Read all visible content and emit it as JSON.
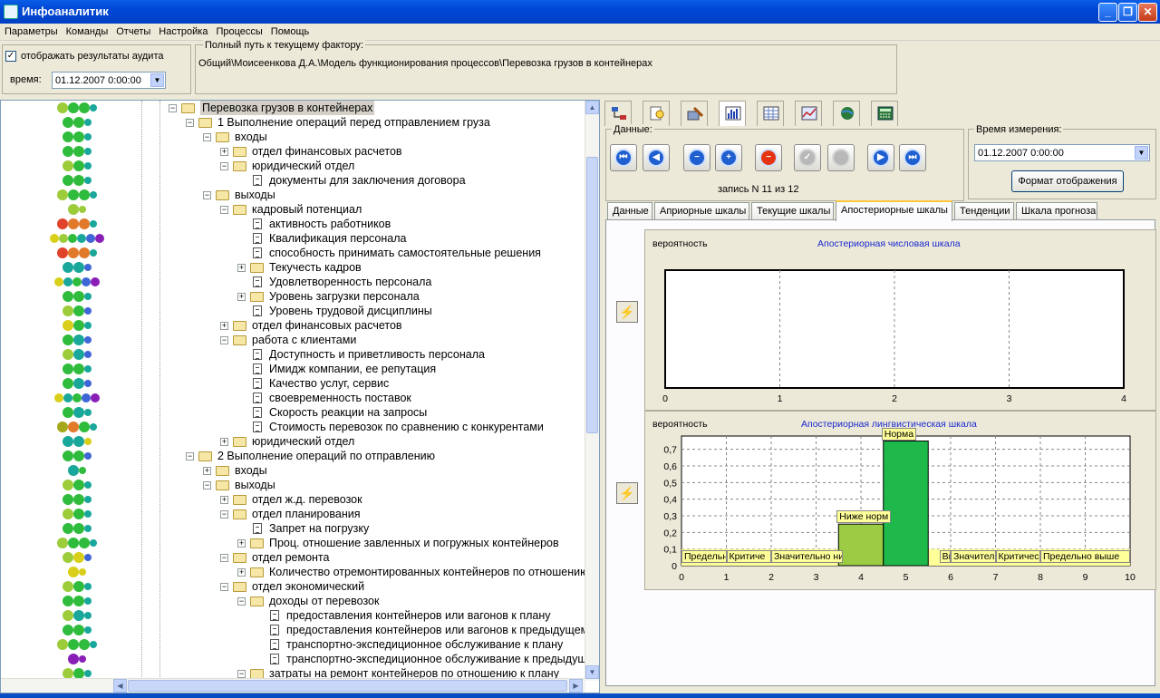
{
  "window": {
    "title": "Инфоаналитик"
  },
  "menu": [
    "Параметры",
    "Команды",
    "Отчеты",
    "Настройка",
    "Процессы",
    "Помощь"
  ],
  "audit": {
    "checkbox_label": "отображать результаты аудита",
    "checked": true,
    "time_label": "время:",
    "time_value": "01.12.2007  0:00:00"
  },
  "path": {
    "legend": "Полный путь к текущему фактору:",
    "value": "Общий\\Моисеенкова Д.А.\\Модель функционирования процессов\\Перевозка грузов в контейнерах"
  },
  "tree": [
    {
      "label": "Перевозка грузов в контейнерах",
      "level": 0,
      "kind": "folder",
      "expander": "-",
      "selected": true
    },
    {
      "label": "1 Выполнение операций перед отправлением груза",
      "level": 1,
      "kind": "folder",
      "expander": "-"
    },
    {
      "label": "входы",
      "level": 2,
      "kind": "folder",
      "expander": "-"
    },
    {
      "label": "отдел финансовых расчетов",
      "level": 3,
      "kind": "folder",
      "expander": "+"
    },
    {
      "label": "юридический отдел",
      "level": 3,
      "kind": "folder",
      "expander": "-"
    },
    {
      "label": "документы для заключения договора",
      "level": 4,
      "kind": "doc",
      "expander": ""
    },
    {
      "label": "выходы",
      "level": 2,
      "kind": "folder",
      "expander": "-"
    },
    {
      "label": "кадровый потенциал",
      "level": 3,
      "kind": "folder",
      "expander": "-"
    },
    {
      "label": "активность работников",
      "level": 4,
      "kind": "doc",
      "expander": ""
    },
    {
      "label": "Квалификация персонала",
      "level": 4,
      "kind": "doc",
      "expander": ""
    },
    {
      "label": "способность принимать самостоятельные решения",
      "level": 4,
      "kind": "doc",
      "expander": ""
    },
    {
      "label": "Текучесть кадров",
      "level": 4,
      "kind": "folder",
      "expander": "+"
    },
    {
      "label": "Удовлетворенность персонала",
      "level": 4,
      "kind": "doc",
      "expander": ""
    },
    {
      "label": "Уровень загрузки персонала",
      "level": 4,
      "kind": "folder",
      "expander": "+"
    },
    {
      "label": "Уровень трудовой дисциплины",
      "level": 4,
      "kind": "doc",
      "expander": ""
    },
    {
      "label": "отдел финансовых расчетов",
      "level": 3,
      "kind": "folder",
      "expander": "+"
    },
    {
      "label": "работа с клиентами",
      "level": 3,
      "kind": "folder",
      "expander": "-"
    },
    {
      "label": "Доступность и приветливость персонала",
      "level": 4,
      "kind": "doc",
      "expander": ""
    },
    {
      "label": "Имидж компании, ее репутация",
      "level": 4,
      "kind": "doc",
      "expander": ""
    },
    {
      "label": "Качество услуг, сервис",
      "level": 4,
      "kind": "doc",
      "expander": ""
    },
    {
      "label": "своевременность поставок",
      "level": 4,
      "kind": "doc",
      "expander": ""
    },
    {
      "label": "Скорость реакции на запросы",
      "level": 4,
      "kind": "doc",
      "expander": ""
    },
    {
      "label": "Стоимость перевозок по сравнению с конкурентами",
      "level": 4,
      "kind": "doc",
      "expander": ""
    },
    {
      "label": "юридический отдел",
      "level": 3,
      "kind": "folder",
      "expander": "+"
    },
    {
      "label": "2 Выполнение операций по отправлению",
      "level": 1,
      "kind": "folder",
      "expander": "-"
    },
    {
      "label": "входы",
      "level": 2,
      "kind": "folder",
      "expander": "+"
    },
    {
      "label": "выходы",
      "level": 2,
      "kind": "folder",
      "expander": "-"
    },
    {
      "label": "отдел ж.д. перевозок",
      "level": 3,
      "kind": "folder",
      "expander": "+"
    },
    {
      "label": "отдел планирования",
      "level": 3,
      "kind": "folder",
      "expander": "-"
    },
    {
      "label": "Запрет на погрузку",
      "level": 4,
      "kind": "doc",
      "expander": ""
    },
    {
      "label": "Проц. отношение завленных и погружных контейнеров",
      "level": 4,
      "kind": "folder",
      "expander": "+"
    },
    {
      "label": "отдел ремонта",
      "level": 3,
      "kind": "folder",
      "expander": "-"
    },
    {
      "label": "Количество отремонтированных контейнеров по отношению",
      "level": 4,
      "kind": "folder",
      "expander": "+"
    },
    {
      "label": "отдел экономический",
      "level": 3,
      "kind": "folder",
      "expander": "-"
    },
    {
      "label": "доходы от перевозок",
      "level": 4,
      "kind": "folder",
      "expander": "-"
    },
    {
      "label": "предоставления контейнеров или вагонов к плану",
      "level": 5,
      "kind": "doc",
      "expander": ""
    },
    {
      "label": "предоставления контейнеров или вагонов к предыдущему",
      "level": 5,
      "kind": "doc",
      "expander": ""
    },
    {
      "label": "транспортно-экспедиционное обслуживание к плану",
      "level": 5,
      "kind": "doc",
      "expander": ""
    },
    {
      "label": "транспортно-экспедиционное обслуживание к предыдущему",
      "level": 5,
      "kind": "doc",
      "expander": ""
    },
    {
      "label": "затраты на ремонт контейнеров по отношению к плану",
      "level": 4,
      "kind": "folder",
      "expander": "-"
    }
  ],
  "indicator_colors": {
    "green": "#2fbb3c",
    "teal": "#18a79a",
    "blue": "#3f66d6",
    "purple": "#8a1fb8",
    "yellow": "#d9cf1a",
    "lime": "#9ccc3a",
    "orange": "#e07a2a",
    "red": "#e0422a",
    "olive": "#a5a81a"
  },
  "indicators": [
    [
      "lime",
      "green",
      "green",
      "teal"
    ],
    [
      "green",
      "green",
      "teal"
    ],
    [
      "green",
      "green",
      "teal"
    ],
    [
      "green",
      "green",
      "teal"
    ],
    [
      "lime",
      "green",
      "teal"
    ],
    [
      "green",
      "green",
      "teal"
    ],
    [
      "lime",
      "green",
      "green",
      "teal"
    ],
    [
      "lime",
      "lime"
    ],
    [
      "red",
      "orange",
      "orange",
      "teal"
    ],
    [
      "yellow",
      "lime",
      "green",
      "teal",
      "blue",
      "purple"
    ],
    [
      "red",
      "orange",
      "orange",
      "teal"
    ],
    [
      "teal",
      "teal",
      "blue"
    ],
    [
      "yellow",
      "teal",
      "green",
      "blue",
      "purple"
    ],
    [
      "green",
      "green",
      "teal"
    ],
    [
      "lime",
      "green",
      "blue"
    ],
    [
      "yellow",
      "green",
      "teal"
    ],
    [
      "green",
      "teal",
      "blue"
    ],
    [
      "lime",
      "teal",
      "blue"
    ],
    [
      "green",
      "green",
      "teal"
    ],
    [
      "green",
      "teal",
      "blue"
    ],
    [
      "yellow",
      "teal",
      "green",
      "blue",
      "purple"
    ],
    [
      "green",
      "teal",
      "teal"
    ],
    [
      "olive",
      "orange",
      "green",
      "teal"
    ],
    [
      "teal",
      "teal",
      "yellow"
    ],
    [
      "green",
      "green",
      "blue"
    ],
    [
      "teal",
      "green"
    ],
    [
      "lime",
      "green",
      "teal"
    ],
    [
      "green",
      "green",
      "teal"
    ],
    [
      "lime",
      "green",
      "teal"
    ],
    [
      "green",
      "green",
      "teal"
    ],
    [
      "lime",
      "green",
      "green",
      "teal"
    ],
    [
      "lime",
      "yellow",
      "blue"
    ],
    [
      "yellow",
      "yellow"
    ],
    [
      "lime",
      "green",
      "teal"
    ],
    [
      "green",
      "green",
      "teal"
    ],
    [
      "lime",
      "teal",
      "teal"
    ],
    [
      "green",
      "green",
      "teal"
    ],
    [
      "lime",
      "green",
      "green",
      "teal"
    ],
    [
      "purple",
      "purple"
    ],
    [
      "lime",
      "green",
      "teal"
    ]
  ],
  "toolbar_icons": [
    "structure-icon",
    "search-doc-icon",
    "edit-icon",
    "bar-chart-icon",
    "table-icon",
    "line-chart-icon",
    "globe-icon",
    "calculator-icon"
  ],
  "data_group": {
    "legend": "Данные:",
    "record": "запись N 11 из 12",
    "nav": [
      {
        "name": "first-record-button",
        "glyph": "⏮",
        "color": "#1f5fcf"
      },
      {
        "name": "prev-record-button",
        "glyph": "◀",
        "color": "#1f5fcf"
      },
      {
        "name": "delete-row-button",
        "glyph": "−",
        "color": "#1f5fcf"
      },
      {
        "name": "add-row-button",
        "glyph": "+",
        "color": "#1f5fcf"
      },
      {
        "name": "stop-button",
        "glyph": "−",
        "color": "#e63312"
      },
      {
        "name": "confirm-button",
        "glyph": "✓",
        "color": "#b8b8b8"
      },
      {
        "name": "cancel-button",
        "glyph": "",
        "color": "#b8b8b8"
      },
      {
        "name": "next-record-button",
        "glyph": "▶",
        "color": "#1f5fcf"
      },
      {
        "name": "last-record-button",
        "glyph": "⏭",
        "color": "#1f5fcf"
      }
    ]
  },
  "measure": {
    "legend": "Время  измерения:",
    "value": "01.12.2007   0:00:00",
    "format_button": "Формат отображения"
  },
  "tabs": [
    "Данные",
    "Априорные шкалы",
    "Текущие шкалы",
    "Апостериорные шкалы",
    "Тенденции",
    "Шкала прогноза"
  ],
  "active_tab": 3,
  "chart_data": [
    {
      "type": "line",
      "title": "Апостериорная числовая шкала",
      "ylabel": "вероятность",
      "x_ticks": [
        0,
        1,
        2,
        3,
        4
      ],
      "xlim": [
        0,
        4
      ],
      "series": [],
      "grid": true
    },
    {
      "type": "bar",
      "title": "Апостериорная лингвистическая шкала",
      "ylabel": "вероятность",
      "x_ticks": [
        0,
        1,
        2,
        3,
        4,
        5,
        6,
        7,
        8,
        9,
        10
      ],
      "y_ticks": [
        "0",
        "0,1",
        "0,2",
        "0,3",
        "0,4",
        "0,5",
        "0,6",
        "0,7"
      ],
      "ylim": [
        0,
        0.78
      ],
      "xlim": [
        0,
        10
      ],
      "bars": [
        {
          "label": "Ниже норм",
          "x": 4,
          "value": 0.25,
          "color": "#9ccc44"
        },
        {
          "label": "Норма",
          "x": 5,
          "value": 0.75,
          "color": "#1fb84a"
        }
      ],
      "category_labels": [
        {
          "label": "Предельно",
          "x": 0.5
        },
        {
          "label": "Критиче",
          "x": 1.5
        },
        {
          "label": "Значительно ни",
          "x": 2.75
        },
        {
          "label": "Выше",
          "x": 5.9
        },
        {
          "label": "Значител",
          "x": 6.5
        },
        {
          "label": "Критичес",
          "x": 7.5
        },
        {
          "label": "Предельно выше",
          "x": 9
        }
      ],
      "grid": true
    }
  ]
}
